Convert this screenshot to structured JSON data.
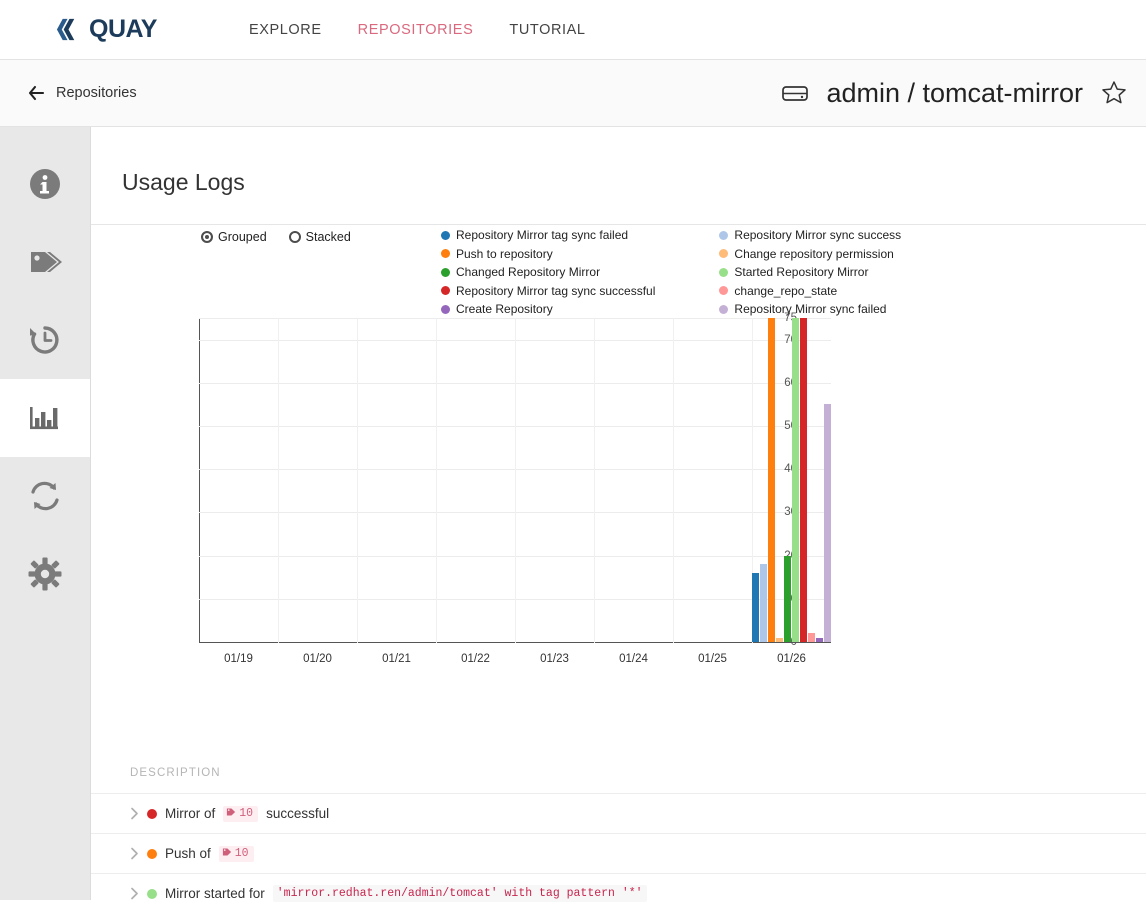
{
  "topnav": {
    "brand": "QUAY",
    "brand_icon": "quay-logo-icon",
    "links": [
      {
        "label": "EXPLORE",
        "active": false
      },
      {
        "label": "REPOSITORIES",
        "active": true
      },
      {
        "label": "TUTORIAL",
        "active": false
      }
    ],
    "active_color": "#d9697e"
  },
  "repo_header": {
    "back_label": "Repositories",
    "back_icon": "arrow-left-icon",
    "repo_icon": "repository-icon",
    "title": "admin / tomcat-mirror",
    "star_icon": "star-outline-icon"
  },
  "sidebar": {
    "items": [
      {
        "name": "information",
        "icon": "info-circle-icon",
        "active": false
      },
      {
        "name": "tags",
        "icon": "tag-icon",
        "active": false
      },
      {
        "name": "tag-history",
        "icon": "history-icon",
        "active": false
      },
      {
        "name": "usage-logs",
        "icon": "bar-chart-icon",
        "active": true
      },
      {
        "name": "mirroring",
        "icon": "sync-icon",
        "active": false
      },
      {
        "name": "settings",
        "icon": "gear-icon",
        "active": false
      }
    ]
  },
  "main": {
    "page_title": "Usage Logs",
    "toggles": [
      {
        "label": "Grouped",
        "selected": true
      },
      {
        "label": "Stacked",
        "selected": false
      }
    ],
    "description_label": "DESCRIPTION",
    "events": [
      {
        "dot_color": "#d62728",
        "chevron": "chevron-right-icon",
        "prefix": "Mirror of",
        "tag_icon": "tag-icon",
        "tag_count": "10",
        "suffix": "successful",
        "code": ""
      },
      {
        "dot_color": "#ff7f0e",
        "chevron": "chevron-right-icon",
        "prefix": "Push of",
        "tag_icon": "tag-icon",
        "tag_count": "10",
        "suffix": "",
        "code": ""
      },
      {
        "dot_color": "#98df8a",
        "chevron": "chevron-right-icon",
        "prefix": "Mirror started for",
        "tag_icon": "",
        "tag_count": "",
        "suffix": "",
        "code": "'mirror.redhat.ren/admin/tomcat' with tag pattern '*'"
      }
    ]
  },
  "chart_data": {
    "type": "bar",
    "title": "Usage Logs",
    "xlabel": "",
    "ylabel": "",
    "grid": true,
    "legend_position": "top-right",
    "ylim": [
      0,
      75
    ],
    "yticks": [
      0,
      10,
      20,
      30,
      40,
      50,
      60,
      70,
      75
    ],
    "categories": [
      "01/19",
      "01/20",
      "01/21",
      "01/22",
      "01/23",
      "01/24",
      "01/25",
      "01/26"
    ],
    "series": [
      {
        "name": "Repository Mirror tag sync failed",
        "color": "#1f77b4",
        "values": [
          0,
          0,
          0,
          0,
          0,
          0,
          0,
          16
        ]
      },
      {
        "name": "Repository Mirror sync success",
        "color": "#aec7e8",
        "values": [
          0,
          0,
          0,
          0,
          0,
          0,
          0,
          18
        ]
      },
      {
        "name": "Push to repository",
        "color": "#ff7f0e",
        "values": [
          0,
          0,
          0,
          0,
          0,
          0,
          0,
          75
        ]
      },
      {
        "name": "Change repository permission",
        "color": "#ffbb78",
        "values": [
          0,
          0,
          0,
          0,
          0,
          0,
          0,
          1
        ]
      },
      {
        "name": "Changed Repository Mirror",
        "color": "#2ca02c",
        "values": [
          0,
          0,
          0,
          0,
          0,
          0,
          0,
          20
        ]
      },
      {
        "name": "Started Repository Mirror",
        "color": "#98df8a",
        "values": [
          0,
          0,
          0,
          0,
          0,
          0,
          0,
          75
        ]
      },
      {
        "name": "Repository Mirror tag sync successful",
        "color": "#d62728",
        "values": [
          0,
          0,
          0,
          0,
          0,
          0,
          0,
          75
        ]
      },
      {
        "name": "change_repo_state",
        "color": "#ff9896",
        "values": [
          0,
          0,
          0,
          0,
          0,
          0,
          0,
          2
        ]
      },
      {
        "name": "Create Repository",
        "color": "#9467bd",
        "values": [
          0,
          0,
          0,
          0,
          0,
          0,
          0,
          1
        ]
      },
      {
        "name": "Repository Mirror sync failed",
        "color": "#c5b0d5",
        "values": [
          0,
          0,
          0,
          0,
          0,
          0,
          0,
          55
        ]
      }
    ],
    "legend_columns": [
      [
        {
          "label": "Repository Mirror tag sync failed",
          "color": "#1f77b4"
        },
        {
          "label": "Push to repository",
          "color": "#ff7f0e"
        },
        {
          "label": "Changed Repository Mirror",
          "color": "#2ca02c"
        },
        {
          "label": "Repository Mirror tag sync successful",
          "color": "#d62728"
        },
        {
          "label": "Create Repository",
          "color": "#9467bd"
        }
      ],
      [
        {
          "label": "Repository Mirror sync success",
          "color": "#aec7e8"
        },
        {
          "label": "Change repository permission",
          "color": "#ffbb78"
        },
        {
          "label": "Started Repository Mirror",
          "color": "#98df8a"
        },
        {
          "label": "change_repo_state",
          "color": "#ff9896"
        },
        {
          "label": "Repository Mirror sync failed",
          "color": "#c5b0d5"
        }
      ]
    ]
  }
}
